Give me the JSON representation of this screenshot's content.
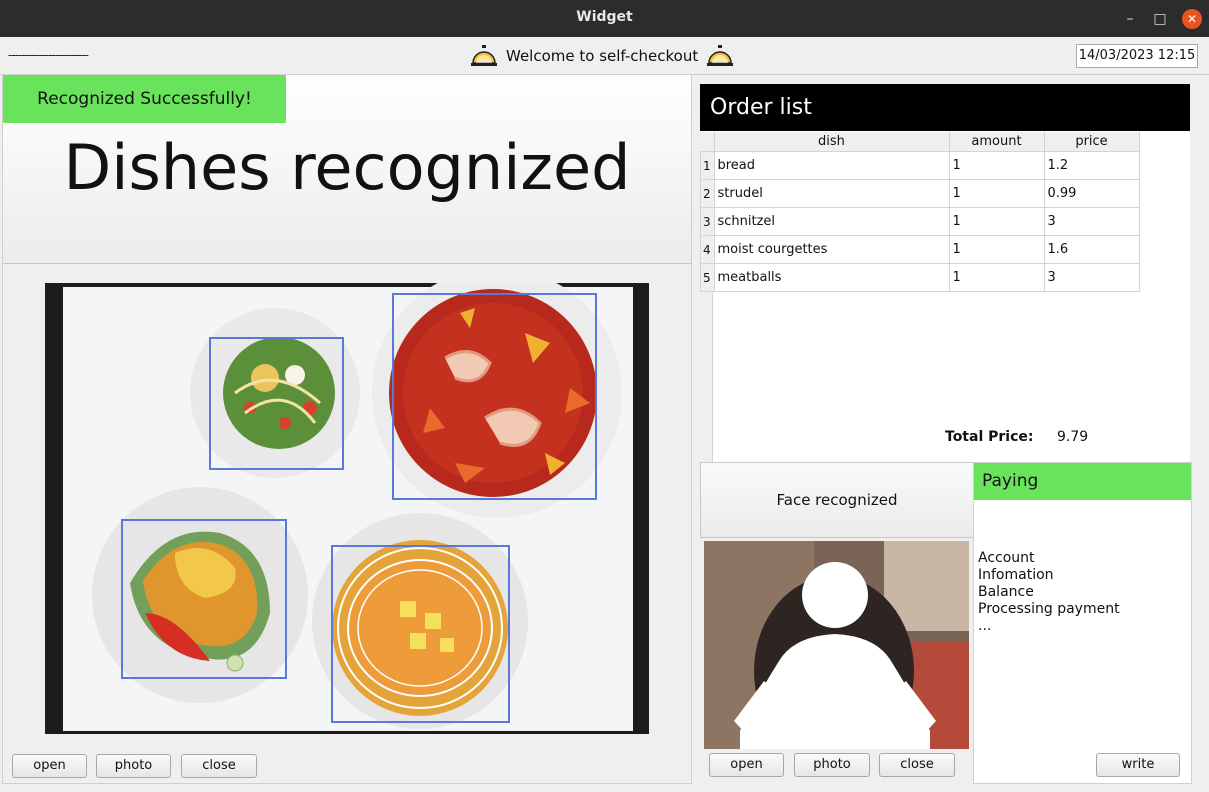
{
  "window": {
    "title": "Widget",
    "minimize_icon": "minimize-icon",
    "maximize_icon": "maximize-icon",
    "close_icon": "close-icon"
  },
  "topbar": {
    "dashes": "------------------------",
    "welcome": "Welcome to self-checkout",
    "datetime": "14/03/2023 12:15"
  },
  "left": {
    "badge": "Recognized Successfully!",
    "title": "Dishes recognized",
    "buttons": {
      "open": "open",
      "photo": "photo",
      "close": "close"
    }
  },
  "order": {
    "title": "Order list",
    "columns": [
      "dish",
      "amount",
      "price"
    ],
    "rows": [
      {
        "n": "1",
        "dish": "bread",
        "amount": "1",
        "price": "1.2"
      },
      {
        "n": "2",
        "dish": "strudel",
        "amount": "1",
        "price": "0.99"
      },
      {
        "n": "3",
        "dish": "schnitzel",
        "amount": "1",
        "price": "3"
      },
      {
        "n": "4",
        "dish": "moist courgettes",
        "amount": "1",
        "price": "1.6"
      },
      {
        "n": "5",
        "dish": "meatballs",
        "amount": "1",
        "price": "3"
      }
    ],
    "total_label": "Total Price:",
    "total_value": "9.79"
  },
  "face": {
    "label": "Face recognized",
    "buttons": {
      "open": "open",
      "photo": "photo",
      "close": "close"
    }
  },
  "paying": {
    "title": "Paying",
    "lines": [
      "Account",
      "Infomation",
      "Balance",
      "Processing payment",
      "..."
    ],
    "write_label": "write"
  },
  "colors": {
    "accent_green": "#6ae35c",
    "titlebar": "#2c2c2c",
    "close_button": "#e95420"
  }
}
